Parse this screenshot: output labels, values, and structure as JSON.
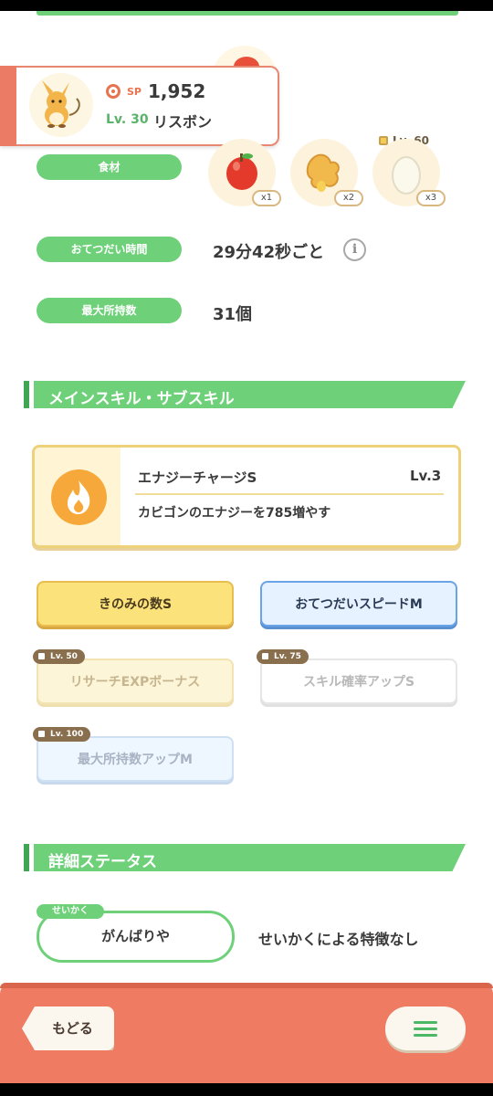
{
  "pokemon": {
    "sp_label": "SP",
    "sp_value": "1,952",
    "level": "Lv. 30",
    "name": "リスボン"
  },
  "stats": {
    "ingredients_label": "食材",
    "ingredients": [
      {
        "name": "apple",
        "qty": "x1"
      },
      {
        "name": "ginger",
        "qty": "x2"
      },
      {
        "name": "egg",
        "qty": "x3",
        "unlock": "Lv. 60"
      }
    ],
    "help_time_label": "おてつだい時間",
    "help_time_value": "29分42秒ごと",
    "max_carry_label": "最大所持数",
    "max_carry_value": "31個"
  },
  "skills_section": {
    "title": "メインスキル・サブスキル",
    "main_skill": {
      "name": "エナジーチャージS",
      "level": "Lv.3",
      "description": "カビゴンのエナジーを785増やす"
    },
    "sub_skills": [
      {
        "label": "きのみの数S",
        "style": "yellow"
      },
      {
        "label": "おてつだいスピードM",
        "style": "blue"
      },
      {
        "label": "リサーチEXPボーナス",
        "lock": "Lv. 50",
        "style": "yellow-dim"
      },
      {
        "label": "スキル確率アップS",
        "lock": "Lv. 75",
        "style": "gray-dim"
      },
      {
        "label": "最大所持数アップM",
        "lock": "Lv. 100",
        "style": "blue-dim"
      }
    ]
  },
  "detail_section": {
    "title": "詳細ステータス",
    "nature_tag": "せいかく",
    "nature_value": "がんばりや",
    "nature_effect": "せいかくによる特徴なし"
  },
  "footer": {
    "back_label": "もどる"
  },
  "colors": {
    "green": "#6fd07a",
    "coral": "#ee7b62",
    "skill_gold": "#f6a93a"
  }
}
